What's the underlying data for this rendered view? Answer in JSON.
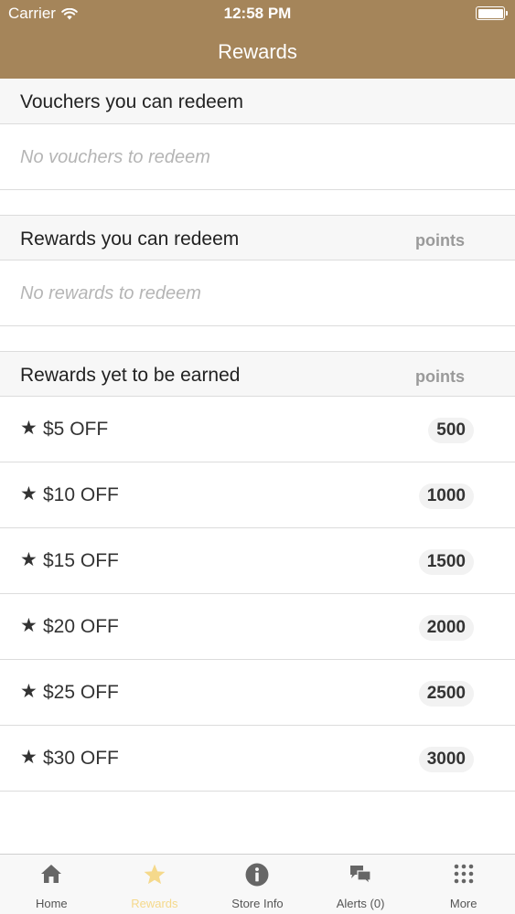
{
  "status_bar": {
    "carrier": "Carrier",
    "time": "12:58 PM"
  },
  "nav": {
    "title": "Rewards"
  },
  "vouchers": {
    "title": "Vouchers you can redeem",
    "empty": "No vouchers to redeem"
  },
  "redeemable": {
    "title": "Rewards you can redeem",
    "points_label": "points",
    "empty": "No rewards to redeem"
  },
  "unearned": {
    "title": "Rewards yet to be earned",
    "points_label": "points",
    "star": "★",
    "items": [
      {
        "label": "$5 OFF",
        "points": "500"
      },
      {
        "label": "$10 OFF",
        "points": "1000"
      },
      {
        "label": "$15 OFF",
        "points": "1500"
      },
      {
        "label": "$20 OFF",
        "points": "2000"
      },
      {
        "label": "$25 OFF",
        "points": "2500"
      },
      {
        "label": "$30 OFF",
        "points": "3000"
      }
    ]
  },
  "tabbar": {
    "tabs": [
      {
        "label": "Home",
        "icon": "home-icon"
      },
      {
        "label": "Rewards",
        "icon": "star-icon",
        "active": true
      },
      {
        "label": "Store Info",
        "icon": "info-icon"
      },
      {
        "label": "Alerts (0)",
        "icon": "chat-bubbles-icon"
      },
      {
        "label": "More",
        "icon": "grid-dots-icon"
      }
    ]
  },
  "colors": {
    "nav_bg": "#a5855a",
    "active_tab": "#f5d98b",
    "icon_gray": "#666666"
  }
}
